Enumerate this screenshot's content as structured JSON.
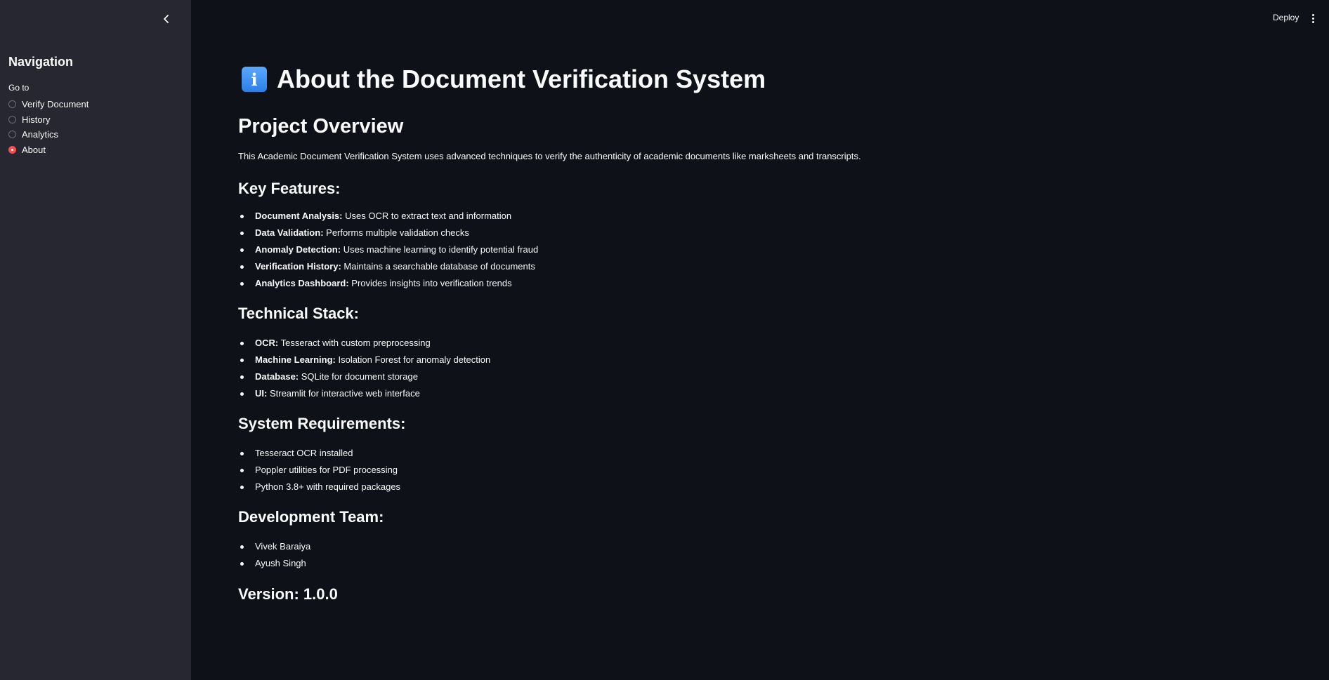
{
  "header": {
    "deploy_label": "Deploy"
  },
  "sidebar": {
    "heading": "Navigation",
    "goto_label": "Go to",
    "options": [
      {
        "label": "Verify Document",
        "selected": false
      },
      {
        "label": "History",
        "selected": false
      },
      {
        "label": "Analytics",
        "selected": false
      },
      {
        "label": "About",
        "selected": true
      }
    ]
  },
  "main": {
    "title_icon": "info-icon",
    "title": "About the Document Verification System",
    "overview_heading": "Project Overview",
    "overview_text": "This Academic Document Verification System uses advanced techniques to verify the authenticity of academic documents like marksheets and transcripts.",
    "features_heading": "Key Features:",
    "features": [
      {
        "term": "Document Analysis:",
        "desc": " Uses OCR to extract text and information"
      },
      {
        "term": "Data Validation:",
        "desc": " Performs multiple validation checks"
      },
      {
        "term": "Anomaly Detection:",
        "desc": " Uses machine learning to identify potential fraud"
      },
      {
        "term": "Verification History:",
        "desc": " Maintains a searchable database of documents"
      },
      {
        "term": "Analytics Dashboard:",
        "desc": " Provides insights into verification trends"
      }
    ],
    "stack_heading": "Technical Stack:",
    "stack": [
      {
        "term": "OCR:",
        "desc": " Tesseract with custom preprocessing"
      },
      {
        "term": "Machine Learning:",
        "desc": " Isolation Forest for anomaly detection"
      },
      {
        "term": "Database:",
        "desc": " SQLite for document storage"
      },
      {
        "term": "UI:",
        "desc": " Streamlit for interactive web interface"
      }
    ],
    "requirements_heading": "System Requirements:",
    "requirements": [
      "Tesseract OCR installed",
      "Poppler utilities for PDF processing",
      "Python 3.8+ with required packages"
    ],
    "team_heading": "Development Team:",
    "team": [
      "Vivek Baraiya",
      "Ayush Singh"
    ],
    "version": "Version: 1.0.0"
  },
  "colors": {
    "background": "#0e1117",
    "sidebar": "#262730",
    "accent": "#ff4b4b",
    "text": "#fafafa"
  }
}
